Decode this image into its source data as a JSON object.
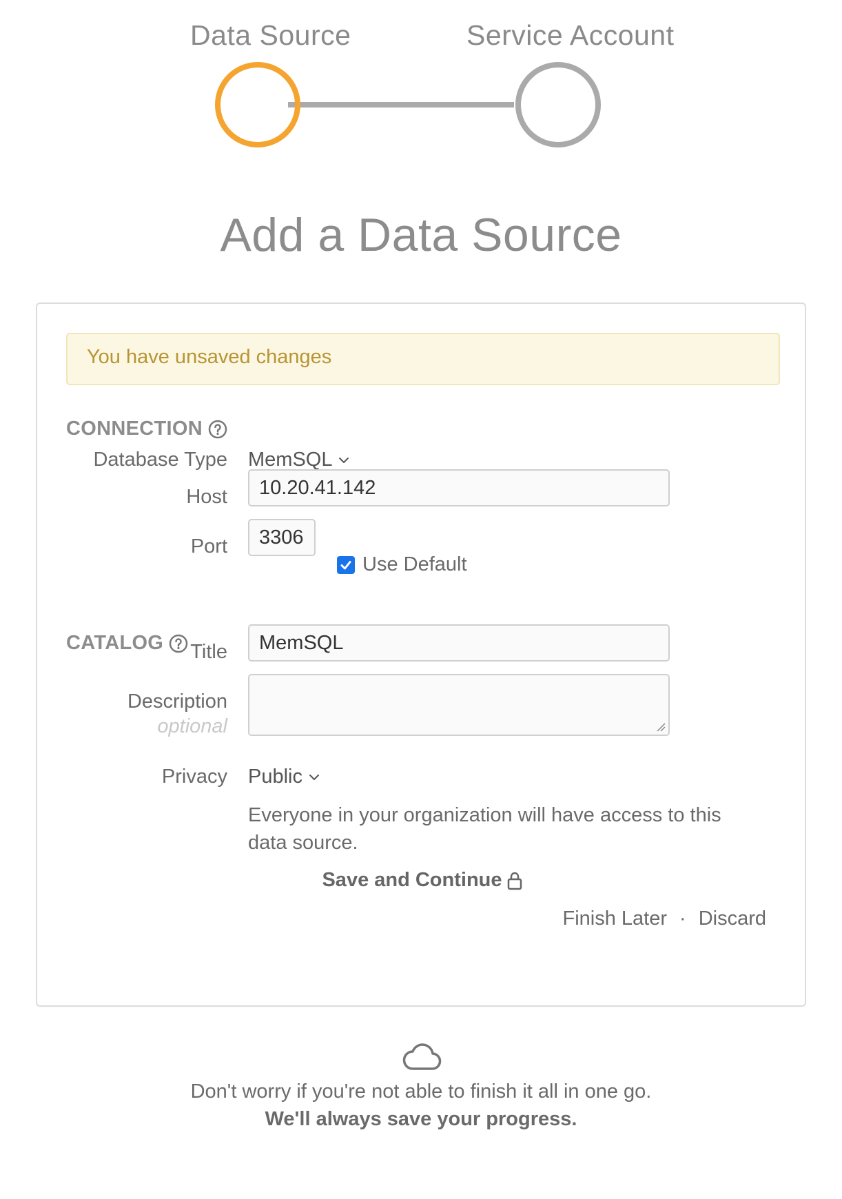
{
  "stepper": {
    "steps": [
      {
        "label": "Data Source",
        "state": "active"
      },
      {
        "label": "Service Account",
        "state": "inactive"
      }
    ],
    "active_color": "#f5a430",
    "inactive_color": "#aaaaaa"
  },
  "page_title": "Add a Data Source",
  "alert": {
    "text": "You have unsaved changes"
  },
  "connection": {
    "section_title": "CONNECTION",
    "database_type_label": "Database Type",
    "database_type_value": "MemSQL",
    "host_label": "Host",
    "host_value": "10.20.41.142",
    "port_label": "Port",
    "port_value": "3306",
    "use_default_label": "Use Default",
    "use_default_checked": true
  },
  "catalog": {
    "section_title": "CATALOG",
    "title_label": "Title",
    "title_value": "MemSQL",
    "description_label": "Description",
    "description_optional": "optional",
    "description_value": "",
    "privacy_label": "Privacy",
    "privacy_value": "Public",
    "privacy_description": "Everyone in your organization will have access to this data source."
  },
  "actions": {
    "save_label": "Save and Continue",
    "finish_later_label": "Finish Later",
    "separator": "·",
    "discard_label": "Discard"
  },
  "footer": {
    "note_line1": "Don't worry if you're not able to finish it all in one go.",
    "note_line2": "We'll always save your progress."
  },
  "colors": {
    "accent": "#f5a430",
    "alert_bg": "#fbf7e3",
    "alert_text": "#b89434",
    "checkbox": "#1a73e8"
  },
  "icons": {
    "help": "question-circle-icon",
    "chevron": "chevron-down-icon",
    "lock": "lock-icon",
    "cloud": "cloud-icon"
  }
}
